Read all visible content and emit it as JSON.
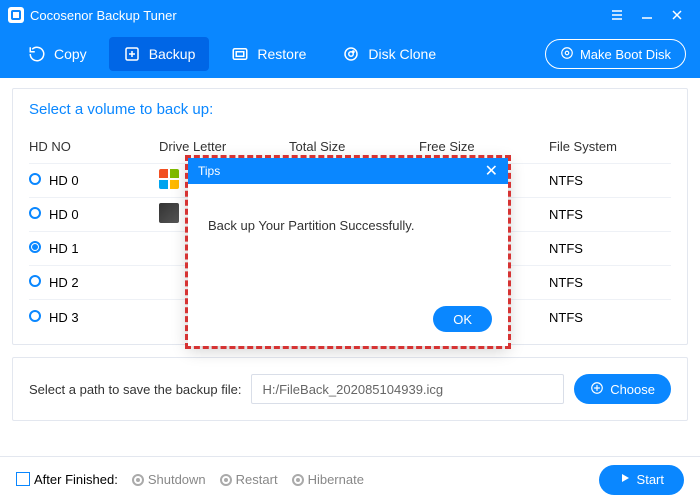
{
  "titlebar": {
    "title": "Cocosenor Backup Tuner"
  },
  "toolbar": {
    "tabs": [
      {
        "label": "Copy",
        "icon": "copy"
      },
      {
        "label": "Backup",
        "icon": "backup",
        "active": true
      },
      {
        "label": "Restore",
        "icon": "restore"
      },
      {
        "label": "Disk Clone",
        "icon": "clone"
      }
    ],
    "boot_label": "Make Boot Disk"
  },
  "panel": {
    "title": "Select a volume to back up:",
    "columns": {
      "hd": "HD NO",
      "dl": "Drive Letter",
      "ts": "Total Size",
      "fs": "Free Size",
      "fsys": "File System"
    },
    "rows": [
      {
        "hd": "HD 0",
        "fsys": "NTFS",
        "selected": false,
        "winlogo": true
      },
      {
        "hd": "HD 0",
        "fsys": "NTFS",
        "selected": false
      },
      {
        "hd": "HD 1",
        "fsys": "NTFS",
        "selected": true
      },
      {
        "hd": "HD 2",
        "fsys": "NTFS",
        "selected": false
      },
      {
        "hd": "HD 3",
        "fsys": "NTFS",
        "selected": false
      }
    ]
  },
  "path": {
    "label": "Select a path to save the backup file:",
    "value": "H:/FileBack_202085104939.icg",
    "choose": "Choose"
  },
  "footer": {
    "after_label": "After Finished:",
    "shutdown": "Shutdown",
    "restart": "Restart",
    "hibernate": "Hibernate",
    "start": "Start"
  },
  "modal": {
    "title": "Tips",
    "message": "Back up Your Partition Successfully.",
    "ok": "OK"
  }
}
